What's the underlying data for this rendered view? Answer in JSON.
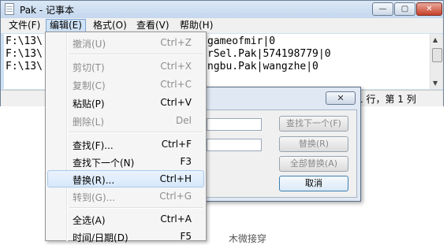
{
  "window": {
    "title": "Pak - 记事本",
    "controls": {
      "minimize": "—",
      "maximize": "▢",
      "close": "✕"
    }
  },
  "menubar": {
    "items": [
      {
        "label": "文件(F)"
      },
      {
        "label": "编辑(E)"
      },
      {
        "label": "格式(O)"
      },
      {
        "label": "查看(V)"
      },
      {
        "label": "帮助(H)"
      }
    ]
  },
  "editor": {
    "lines": [
      {
        "left": "F:\\13\\",
        "right": "gameofmir|0"
      },
      {
        "left": "F:\\13\\",
        "right": "rSel.Pak|574198779|0"
      },
      {
        "left": "F:\\13\\",
        "right": "ngbu.Pak|wangzhe|0"
      }
    ]
  },
  "statusbar": {
    "position": "1 行，第 1 列"
  },
  "dialog": {
    "buttons": {
      "find_next": "查找下一个(F)",
      "replace": "替换(R)",
      "replace_all": "全部替换(A)",
      "cancel": "取消"
    }
  },
  "edit_menu": {
    "items": [
      {
        "label": "撤消(U)",
        "shortcut": "Ctrl+Z",
        "enabled": false
      },
      {
        "label": "剪切(T)",
        "shortcut": "Ctrl+X",
        "enabled": false
      },
      {
        "label": "复制(C)",
        "shortcut": "Ctrl+C",
        "enabled": false
      },
      {
        "label": "粘贴(P)",
        "shortcut": "Ctrl+V",
        "enabled": true
      },
      {
        "label": "删除(L)",
        "shortcut": "Del",
        "enabled": false
      },
      {
        "label": "查找(F)...",
        "shortcut": "Ctrl+F",
        "enabled": true
      },
      {
        "label": "查找下一个(N)",
        "shortcut": "F3",
        "enabled": true
      },
      {
        "label": "替换(R)...",
        "shortcut": "Ctrl+H",
        "enabled": true,
        "highlighted": true
      },
      {
        "label": "转到(G)...",
        "shortcut": "Ctrl+G",
        "enabled": false
      },
      {
        "label": "全选(A)",
        "shortcut": "Ctrl+A",
        "enabled": true
      },
      {
        "label": "时间/日期(D)",
        "shortcut": "F5",
        "enabled": true
      }
    ]
  },
  "background_text": "木微接穿"
}
